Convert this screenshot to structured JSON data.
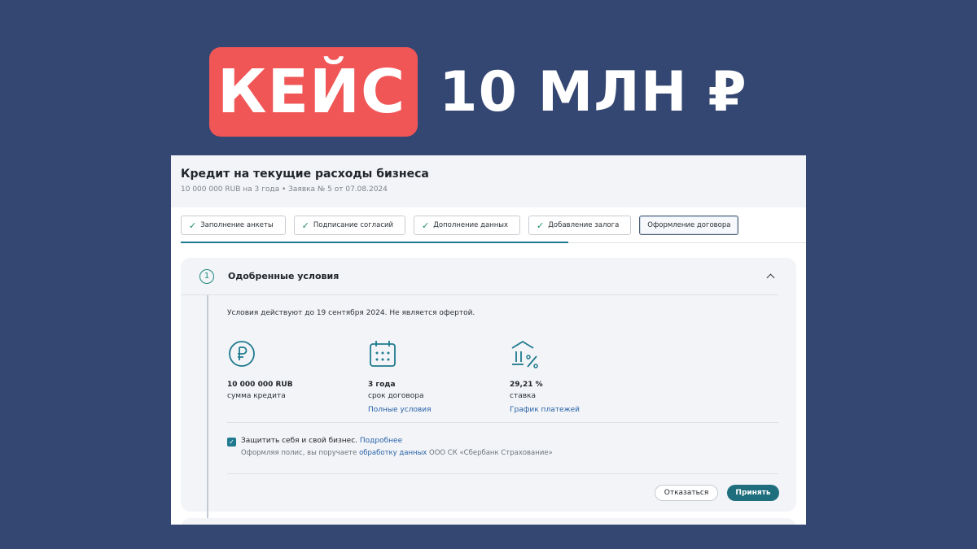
{
  "headline": {
    "badge": "КЕЙС",
    "rest": "10 МЛН ₽"
  },
  "screen": {
    "title": "Кредит на текущие расходы бизнеса",
    "subtitle": "10 000 000 RUB на 3 года • Заявка № 5 от 07.08.2024",
    "steps": [
      {
        "label": "Заполнение анкеты",
        "done": true
      },
      {
        "label": "Подписание согласий",
        "done": true
      },
      {
        "label": "Дополнение данных",
        "done": true
      },
      {
        "label": "Добавление залога",
        "done": true
      },
      {
        "label": "Оформление договора",
        "done": false,
        "current": true
      }
    ],
    "progress_fraction": 0.62,
    "card": {
      "step_number": "1",
      "title": "Одобренные условия",
      "validity": "Условия действуют до 19 сентября 2024. Не является офертой.",
      "terms": [
        {
          "icon": "ruble-circle-icon",
          "value": "10 000 000 RUB",
          "label": "сумма кредита",
          "link": ""
        },
        {
          "icon": "calendar-icon",
          "value": "3 года",
          "label": "срок договора",
          "link": "Полные условия"
        },
        {
          "icon": "bank-percent-icon",
          "value": "29,21 %",
          "label": "ставка",
          "link": "График платежей"
        }
      ],
      "insurance": {
        "checked": true,
        "text": "Защитить себя и свой бизнес.",
        "more_link": "Подробнее",
        "note_before": "Оформляя полис, вы поручаете",
        "note_link": "обработку данных",
        "note_after": "ООО СК «Сбербанк Страхование»"
      },
      "decline_label": "Отказаться",
      "accept_label": "Принять"
    }
  },
  "colors": {
    "background": "#344672",
    "badge": "#f15656",
    "accent": "#1f7a8f",
    "link": "#2a62a8"
  }
}
